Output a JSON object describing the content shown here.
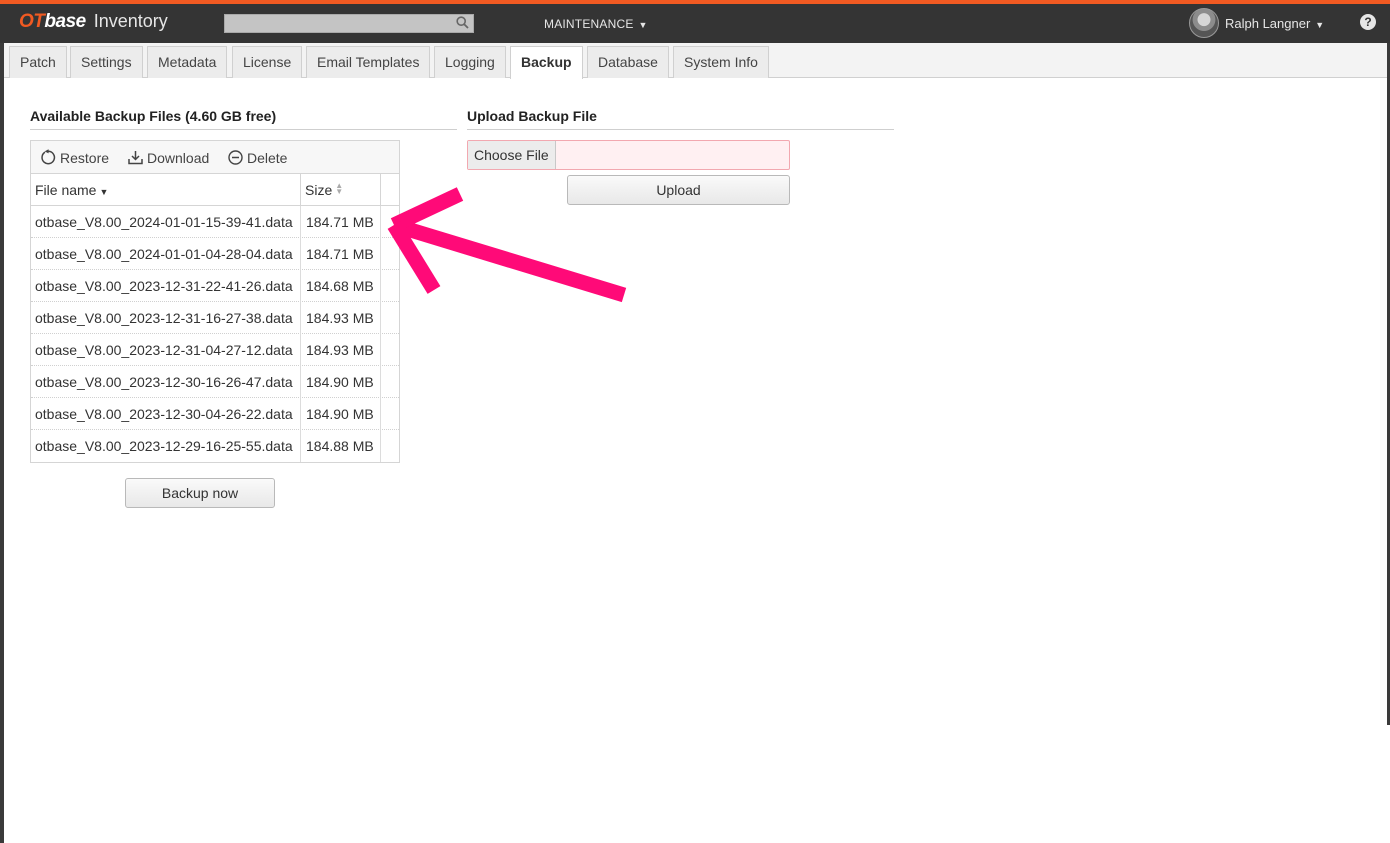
{
  "app": {
    "logo_ot": "OT",
    "logo_base": "base",
    "logo_name": "Inventory",
    "menu_label": "MAINTENANCE",
    "user_name": "Ralph Langner",
    "help_label": "?"
  },
  "tabs": [
    {
      "label": "Patch"
    },
    {
      "label": "Settings"
    },
    {
      "label": "Metadata"
    },
    {
      "label": "License"
    },
    {
      "label": "Email Templates"
    },
    {
      "label": "Logging"
    },
    {
      "label": "Backup",
      "active": true
    },
    {
      "label": "Database"
    },
    {
      "label": "System Info"
    }
  ],
  "backup": {
    "title": "Available Backup Files (4.60 GB free)",
    "toolbar": {
      "restore": "Restore",
      "download": "Download",
      "delete": "Delete"
    },
    "columns": {
      "file_name": "File name",
      "size": "Size"
    },
    "files": [
      {
        "name": "otbase_V8.00_2024-01-01-15-39-41.data",
        "size": "184.71 MB"
      },
      {
        "name": "otbase_V8.00_2024-01-01-04-28-04.data",
        "size": "184.71 MB"
      },
      {
        "name": "otbase_V8.00_2023-12-31-22-41-26.data",
        "size": "184.68 MB"
      },
      {
        "name": "otbase_V8.00_2023-12-31-16-27-38.data",
        "size": "184.93 MB"
      },
      {
        "name": "otbase_V8.00_2023-12-31-04-27-12.data",
        "size": "184.93 MB"
      },
      {
        "name": "otbase_V8.00_2023-12-30-16-26-47.data",
        "size": "184.90 MB"
      },
      {
        "name": "otbase_V8.00_2023-12-30-04-26-22.data",
        "size": "184.90 MB"
      },
      {
        "name": "otbase_V8.00_2023-12-29-16-25-55.data",
        "size": "184.88 MB"
      }
    ],
    "backup_now": "Backup now"
  },
  "upload": {
    "title": "Upload Backup File",
    "choose_file": "Choose File",
    "upload_button": "Upload"
  },
  "colors": {
    "accent": "#f15a22",
    "navbar": "#343434",
    "annotation_arrow": "#ff0a78"
  }
}
